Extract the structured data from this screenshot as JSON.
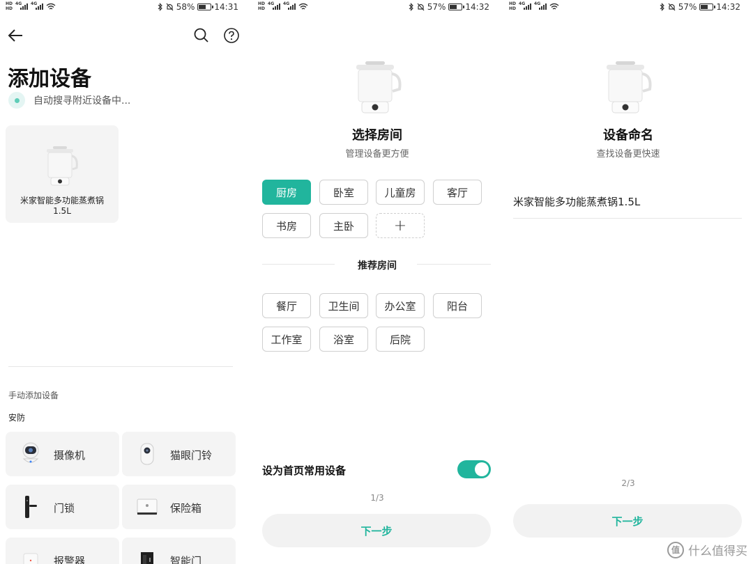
{
  "status": {
    "s1": {
      "battery": "58%",
      "time": "14:31",
      "battery_level": 0.58
    },
    "s2": {
      "battery": "57%",
      "time": "14:32",
      "battery_level": 0.57
    },
    "s3": {
      "battery": "57%",
      "time": "14:32",
      "battery_level": 0.57
    },
    "network": "4G",
    "hd": "HD"
  },
  "add_device": {
    "title": "添加设备",
    "searching_text": "自动搜寻附近设备中...",
    "found_device": {
      "name_line1": "米家智能多功能蒸煮锅",
      "name_line2": "1.5L",
      "icon": "kettle-icon"
    },
    "manual_title": "手动添加设备",
    "category": "安防",
    "devices": [
      {
        "label": "摄像机",
        "icon": "camera-icon"
      },
      {
        "label": "猫眼门铃",
        "icon": "doorbell-icon"
      },
      {
        "label": "门锁",
        "icon": "door-lock-icon"
      },
      {
        "label": "保险箱",
        "icon": "safe-icon"
      },
      {
        "label": "报警器",
        "icon": "alarm-icon"
      },
      {
        "label": "智能门",
        "icon": "smart-door-icon"
      }
    ]
  },
  "choose_room": {
    "title": "选择房间",
    "subtitle": "管理设备更方便",
    "rooms": [
      "厨房",
      "卧室",
      "儿童房",
      "客厅",
      "书房",
      "主卧"
    ],
    "selected_room": "厨房",
    "add_room": "+",
    "recommended_title": "推荐房间",
    "recommended": [
      "餐厅",
      "卫生间",
      "办公室",
      "阳台",
      "工作室",
      "浴室",
      "后院"
    ],
    "favorite_label": "设为首页常用设备",
    "favorite_enabled": true,
    "pager": "1/3",
    "next": "下一步"
  },
  "name_device": {
    "title": "设备命名",
    "subtitle": "查找设备更快速",
    "device_name": "米家智能多功能蒸煮锅1.5L",
    "pager": "2/3",
    "next": "下一步"
  },
  "watermark": {
    "text": "什么值得买",
    "logo": "值"
  },
  "colors": {
    "accent": "#21b59d",
    "card": "#f4f4f4",
    "chip_border": "#cfcfcf"
  }
}
